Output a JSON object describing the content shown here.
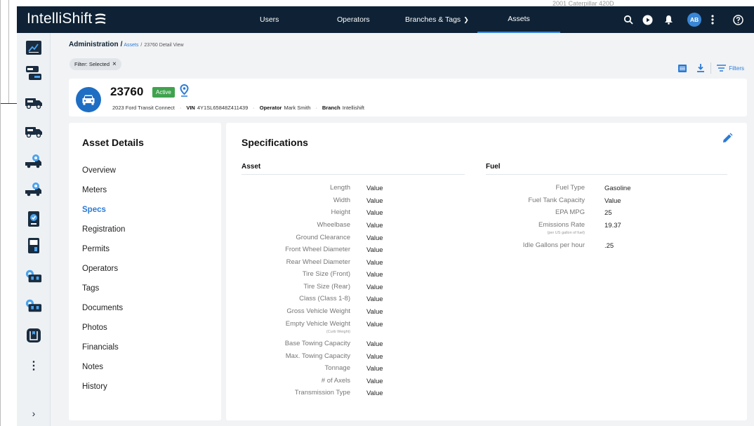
{
  "background": {
    "window_text": "2001 Caterpillar 420D"
  },
  "topbar": {
    "brand": "IntelliShift",
    "nav": [
      {
        "label": "Users"
      },
      {
        "label": "Operators"
      },
      {
        "label": "Branches & Tags"
      },
      {
        "label": "Assets"
      }
    ],
    "user_initials": "AB"
  },
  "breadcrumb": {
    "root": "Administration",
    "link": "Assets",
    "current": "23760 Detail View"
  },
  "filter": {
    "label": "Filter: Selected"
  },
  "tools": {
    "filters_label": "Filters"
  },
  "asset": {
    "id": "23760",
    "status": "Active",
    "vehicle": "2023 Ford Transit Connect",
    "vin_label": "VIN",
    "vin": "4Y1SL65848Z411439",
    "operator_label": "Operator",
    "operator": "Mark Smith",
    "branch_label": "Branch",
    "branch": "Intellishift"
  },
  "details": {
    "title": "Asset Details",
    "items": [
      {
        "label": "Overview"
      },
      {
        "label": "Meters"
      },
      {
        "label": "Specs"
      },
      {
        "label": "Registration"
      },
      {
        "label": "Permits"
      },
      {
        "label": "Operators"
      },
      {
        "label": "Tags"
      },
      {
        "label": "Documents"
      },
      {
        "label": "Photos"
      },
      {
        "label": "Financials"
      },
      {
        "label": "Notes"
      },
      {
        "label": "History"
      }
    ],
    "active_index": 2
  },
  "specs": {
    "title": "Specifications",
    "asset_section": "Asset",
    "fuel_section": "Fuel",
    "asset_rows": [
      {
        "label": "Length",
        "sub": "",
        "value": "Value"
      },
      {
        "label": "Width",
        "sub": "",
        "value": "Value"
      },
      {
        "label": "Height",
        "sub": "",
        "value": "Value"
      },
      {
        "label": "Wheelbase",
        "sub": "",
        "value": "Value"
      },
      {
        "label": "Ground Clearance",
        "sub": "",
        "value": "Value"
      },
      {
        "label": "Front Wheel Diameter",
        "sub": "",
        "value": "Value"
      },
      {
        "label": "Rear Wheel Diameter",
        "sub": "",
        "value": "Value"
      },
      {
        "label": "Tire Size (Front)",
        "sub": "",
        "value": "Value"
      },
      {
        "label": "Tire Size (Rear)",
        "sub": "",
        "value": "Value"
      },
      {
        "label": "Class (Class 1-8)",
        "sub": "",
        "value": "Value"
      },
      {
        "label": "Gross Vehicle Weight",
        "sub": "",
        "value": "Value"
      },
      {
        "label": "Empty Vehicle Weight",
        "sub": "(Curb Weight)",
        "value": "Value"
      },
      {
        "label": "Base Towing Capacity",
        "sub": "",
        "value": "Value"
      },
      {
        "label": "Max. Towing Capacity",
        "sub": "",
        "value": "Value"
      },
      {
        "label": "Tonnage",
        "sub": "",
        "value": "Value"
      },
      {
        "label": "# of Axels",
        "sub": "",
        "value": "Value"
      },
      {
        "label": "Transmission Type",
        "sub": "",
        "value": "Value"
      }
    ],
    "fuel_rows": [
      {
        "label": "Fuel Type",
        "sub": "",
        "value": "Gasoline"
      },
      {
        "label": "Fuel Tank Capacity",
        "sub": "",
        "value": "Value"
      },
      {
        "label": "EPA MPG",
        "sub": "",
        "value": "25"
      },
      {
        "label": "Emissions Rate",
        "sub": "(per US gallon of fuel)",
        "value": "19.37"
      },
      {
        "label": "Idle Gallons per hour",
        "sub": "",
        "value": ".25"
      }
    ]
  },
  "colors": {
    "navbar": "#0f2235",
    "accent": "#2c7bd6",
    "active_badge": "#3fa34d",
    "sidebar_icon": "#1a2c3f"
  },
  "sidebar_icons": [
    "dashboard-icon",
    "route-icon",
    "truck-icon",
    "truck-icon",
    "truck-settings-icon",
    "truck-settings-icon",
    "device-icon",
    "terminal-icon",
    "gear-truck-icon",
    "gear-truck-icon",
    "book-icon"
  ]
}
